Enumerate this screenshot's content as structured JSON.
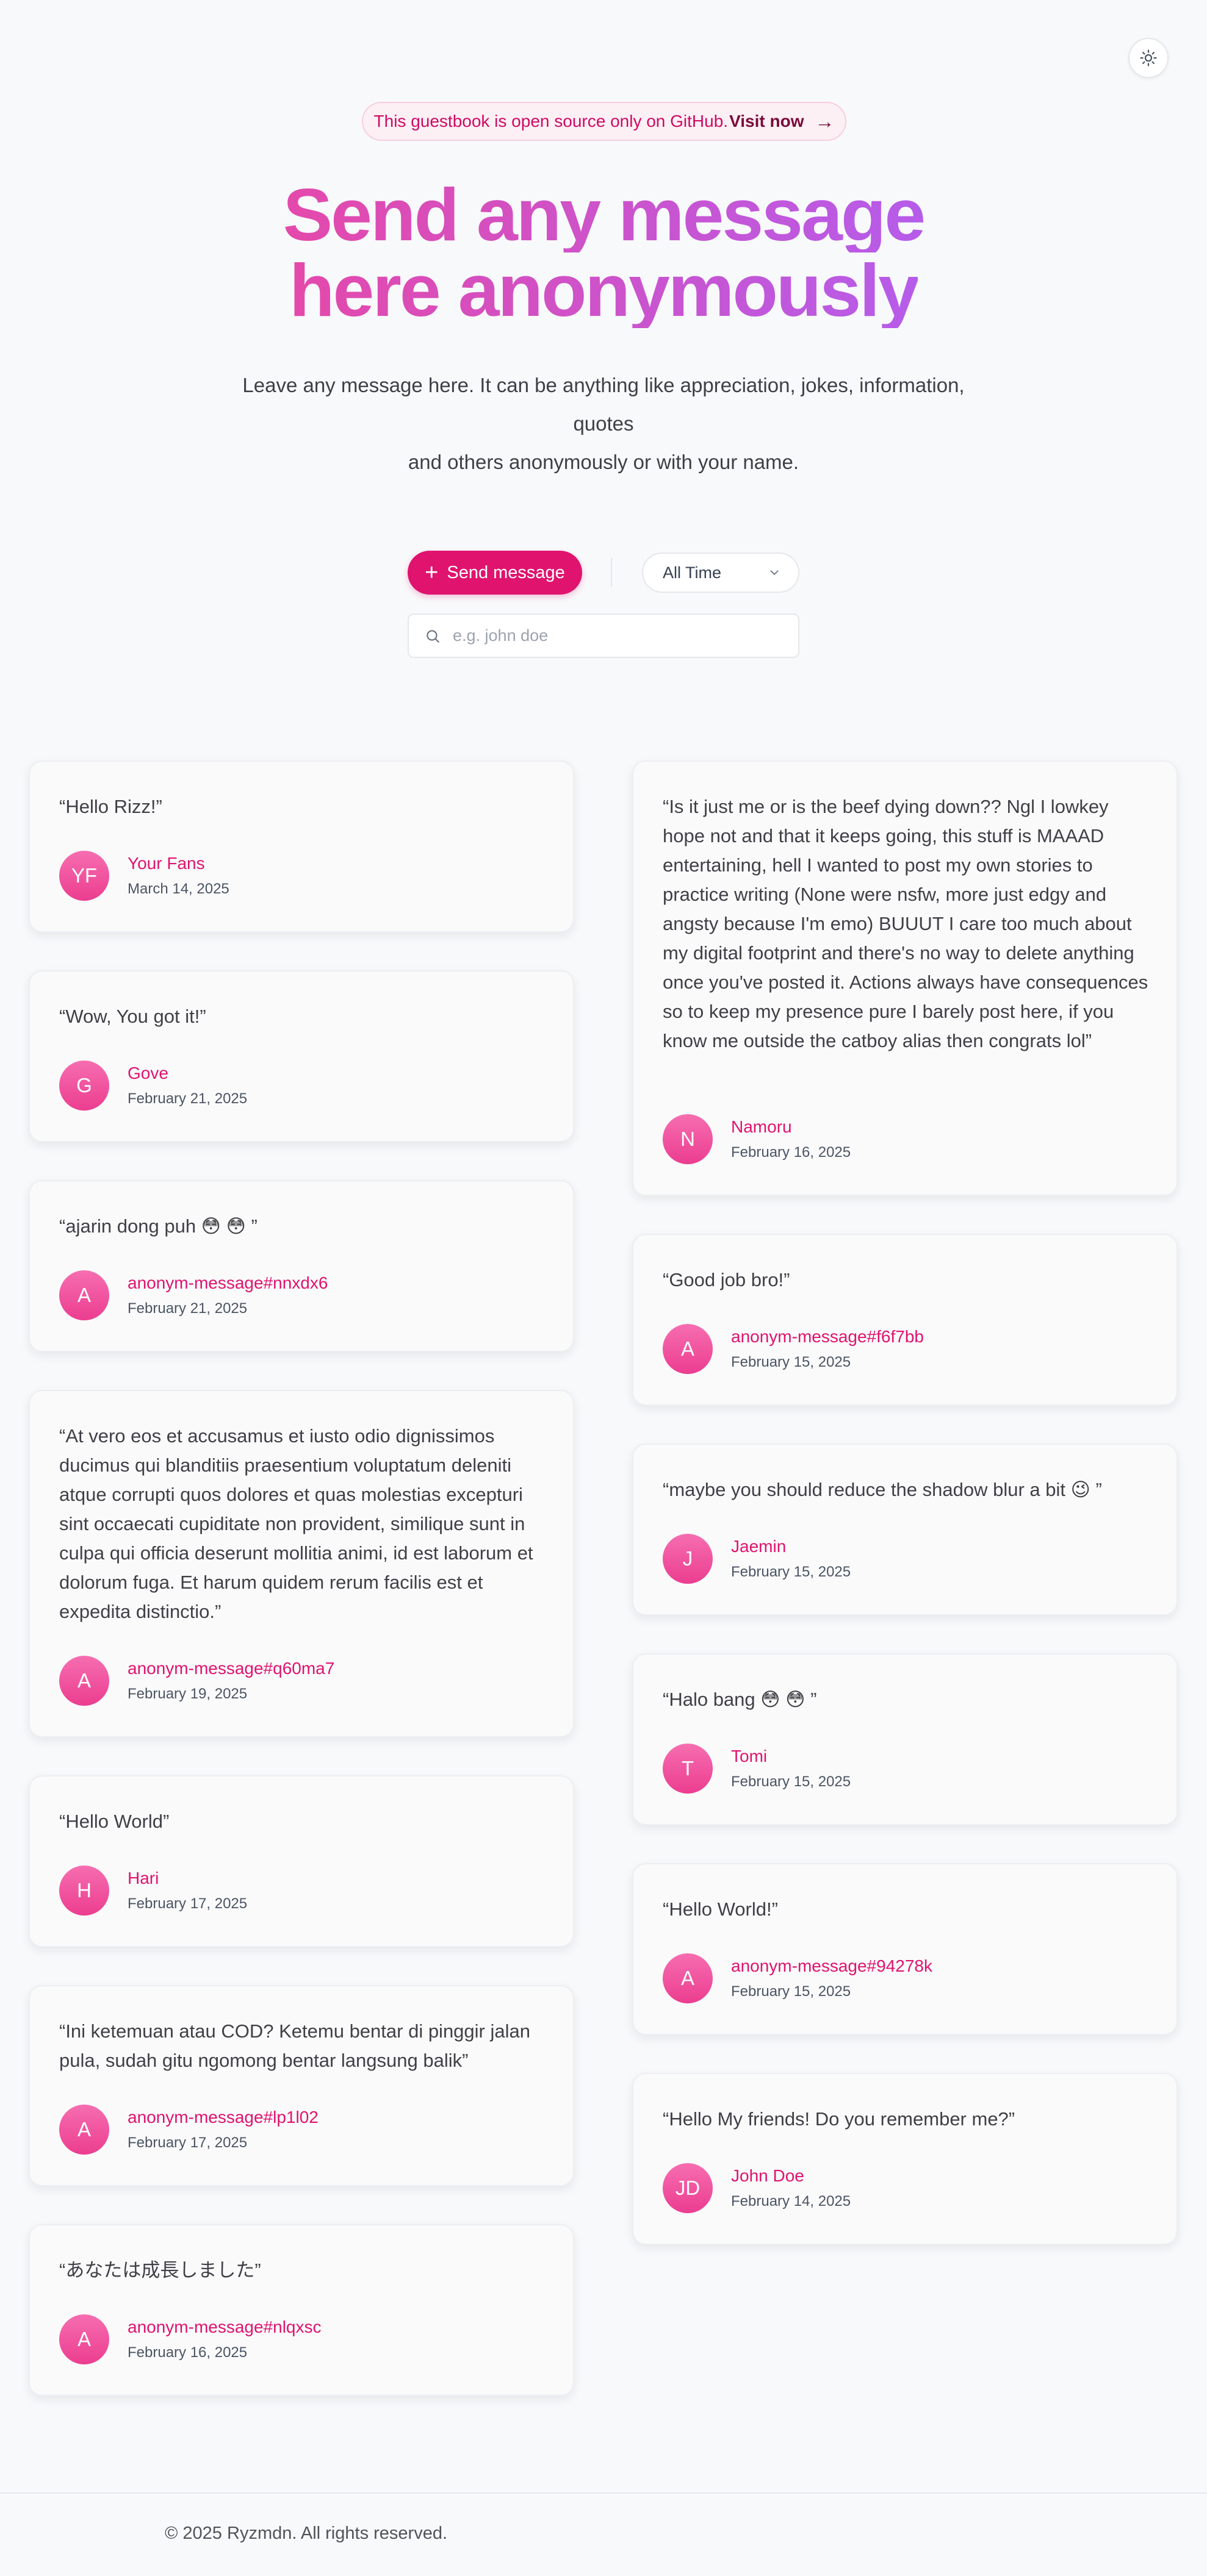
{
  "theme_toggle": {
    "icon": "sun-icon"
  },
  "banner": {
    "text": "This guestbook is open source only on GitHub.",
    "link": "Visit now",
    "arrow": "→"
  },
  "hero": {
    "title_line1": "Send any message",
    "title_line2": "here anonymously",
    "subtitle_line1": "Leave any message here. It can be anything like appreciation, jokes, information, quotes",
    "subtitle_line2": "and others anonymously or with your name."
  },
  "controls": {
    "send_label": "Send message",
    "filter_value": "All Time",
    "search_placeholder": "e.g. john doe"
  },
  "messages_left": [
    {
      "text": "“Hello Rizz!”",
      "initials": "YF",
      "name": "Your Fans",
      "date": "March 14, 2025"
    },
    {
      "text": "“Wow, You got it!”",
      "initials": "G",
      "name": "Gove",
      "date": "February 21, 2025"
    },
    {
      "text": "“ajarin dong puh 😳 😳 ”",
      "initials": "A",
      "name": "anonym-message#nnxdx6",
      "date": "February 21, 2025"
    },
    {
      "text": "“At vero eos et accusamus et iusto odio dignissimos ducimus qui blanditiis praesentium voluptatum deleniti atque corrupti quos dolores et quas molestias excepturi sint occaecati cupiditate non provident, similique sunt in culpa qui officia deserunt mollitia animi, id est laborum et dolorum fuga. Et harum quidem rerum facilis est et expedita distinctio.”",
      "initials": "A",
      "name": "anonym-message#q60ma7",
      "date": "February 19, 2025"
    },
    {
      "text": "“Hello World”",
      "initials": "H",
      "name": "Hari",
      "date": "February 17, 2025"
    },
    {
      "text": "“Ini ketemuan atau COD? Ketemu bentar di pinggir jalan pula, sudah gitu ngomong bentar langsung balik”",
      "initials": "A",
      "name": "anonym-message#lp1l02",
      "date": "February 17, 2025"
    },
    {
      "text": "“あなたは成長しました”",
      "initials": "A",
      "name": "anonym-message#nlqxsc",
      "date": "February 16, 2025"
    }
  ],
  "messages_right": [
    {
      "text": "“Is it just me or is the beef dying down?? Ngl I lowkey hope not and that it keeps going, this stuff is MAAAD entertaining, hell I wanted to post my own stories to practice writing (None were nsfw, more just edgy and angsty because I'm emo) BUUUT I care too much about my digital footprint and there's no way to delete anything once you've posted it. Actions always have consequences so to keep my presence pure I barely post here, if you know me outside the catboy alias then congrats lol”",
      "initials": "N",
      "name": "Namoru",
      "date": "February 16, 2025"
    },
    {
      "text": "“Good job bro!”",
      "initials": "A",
      "name": "anonym-message#f6f7bb",
      "date": "February 15, 2025"
    },
    {
      "text": "“maybe you should reduce the shadow blur a bit 😉 ”",
      "initials": "J",
      "name": "Jaemin",
      "date": "February 15, 2025"
    },
    {
      "text": "“Halo bang 😳 😳 ”",
      "initials": "T",
      "name": "Tomi",
      "date": "February 15, 2025"
    },
    {
      "text": "“Hello World!”",
      "initials": "A",
      "name": "anonym-message#94278k",
      "date": "February 15, 2025"
    },
    {
      "text": "“Hello My friends! Do you remember me?”",
      "initials": "JD",
      "name": "John Doe",
      "date": "February 14, 2025"
    }
  ],
  "footer": {
    "text": "© 2025 Ryzmdn. All rights reserved."
  }
}
